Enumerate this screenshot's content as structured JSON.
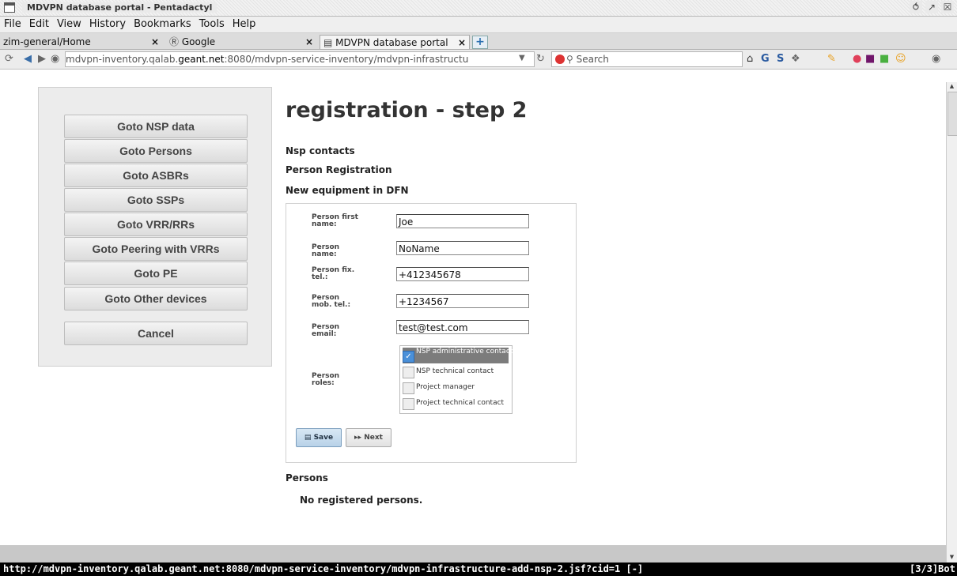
{
  "window": {
    "title": "MDVPN database portal - Pentadactyl",
    "controls": [
      "⥀",
      "↗",
      "☒"
    ]
  },
  "menu": [
    "File",
    "Edit",
    "View",
    "History",
    "Bookmarks",
    "Tools",
    "Help"
  ],
  "tabs": [
    {
      "label": "zim-general/Home",
      "close": "×"
    },
    {
      "label": "Google",
      "close": "×"
    },
    {
      "label": "MDVPN database portal",
      "close": "×"
    }
  ],
  "toolbar": {
    "url_prefix": "mdvpn-inventory.qalab.",
    "url_host": "geant.net",
    "url_suffix": ":8080/mdvpn-service-inventory/mdvpn-infrastructu",
    "search_placeholder": "Search"
  },
  "sidebar": {
    "buttons": [
      "Goto NSP data",
      "Goto Persons",
      "Goto ASBRs",
      "Goto SSPs",
      "Goto VRR/RRs",
      "Goto Peering with VRRs",
      "Goto PE",
      "Goto Other devices"
    ],
    "cancel": "Cancel"
  },
  "main": {
    "heading": "registration - step 2",
    "sections": [
      "Nsp contacts",
      "Person Registration",
      "New equipment in DFN"
    ],
    "form": {
      "fields": [
        {
          "label": "Person first name:",
          "value": "Joe"
        },
        {
          "label": "Person name:",
          "value": "NoName"
        },
        {
          "label": "Person fix. tel.:",
          "value": "+412345678"
        },
        {
          "label": "Person mob. tel.:",
          "value": "+1234567"
        },
        {
          "label": "Person email:",
          "value": "test@test.com"
        }
      ],
      "roles_label": "Person roles:",
      "roles": [
        {
          "label": "NSP administrative contact",
          "checked": true
        },
        {
          "label": "NSP technical contact",
          "checked": false
        },
        {
          "label": "Project manager",
          "checked": false
        },
        {
          "label": "Project technical contact",
          "checked": false
        }
      ],
      "save_label": "Save",
      "next_label": "Next"
    },
    "persons_title": "Persons",
    "persons_empty": "No registered persons."
  },
  "statusbar": {
    "url": "http://mdvpn-inventory.qalab.geant.net:8080/mdvpn-service-inventory/mdvpn-infrastructure-add-nsp-2.jsf?cid=1 [-]",
    "position": "[3/3]Bot"
  }
}
